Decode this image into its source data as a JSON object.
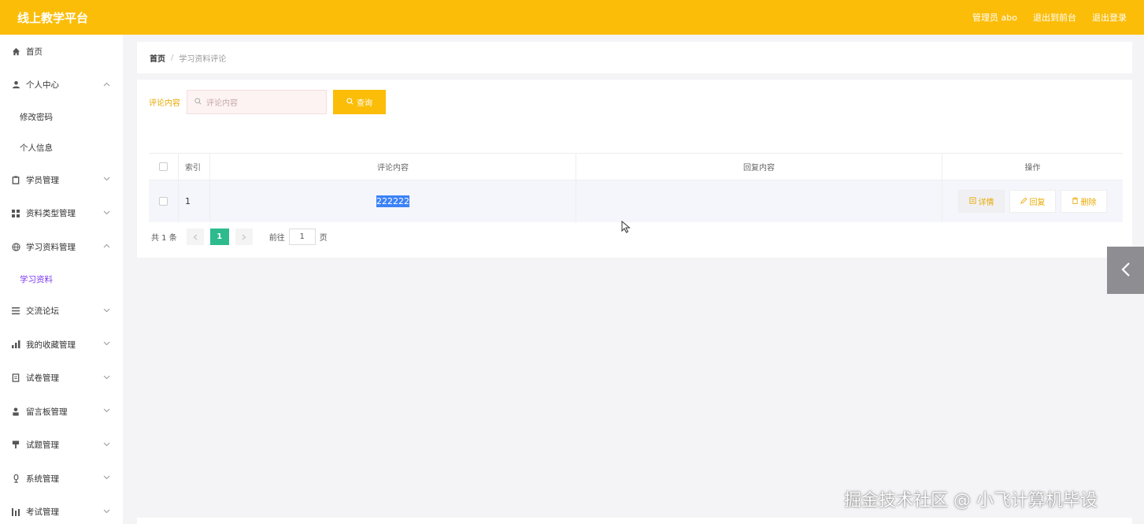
{
  "header": {
    "brand": "线上教学平台",
    "admin_label": "管理员 abo",
    "exit_front": "退出到前台",
    "logout": "退出登录",
    "bg_color": "#fbbd08"
  },
  "sidebar": {
    "items": [
      {
        "label": "首页",
        "icon": "home-icon"
      },
      {
        "label": "个人中心",
        "icon": "user-icon",
        "expanded": true,
        "children": [
          "修改密码",
          "个人信息"
        ]
      },
      {
        "label": "学员管理",
        "icon": "clipboard-icon"
      },
      {
        "label": "资料类型管理",
        "icon": "grid-icon"
      },
      {
        "label": "学习资料管理",
        "icon": "globe-icon",
        "expanded": true,
        "children": [
          "学习资料"
        ]
      },
      {
        "label": "交流论坛",
        "icon": "list-icon"
      },
      {
        "label": "我的收藏管理",
        "icon": "chart-icon"
      },
      {
        "label": "试卷管理",
        "icon": "doc-icon"
      },
      {
        "label": "留言板管理",
        "icon": "person-icon"
      },
      {
        "label": "试题管理",
        "icon": "tag-icon"
      },
      {
        "label": "系统管理",
        "icon": "mic-icon"
      },
      {
        "label": "考试管理",
        "icon": "bars-icon"
      }
    ]
  },
  "breadcrumb": {
    "home": "首页",
    "separator": "/",
    "current": "学习资料评论"
  },
  "search": {
    "label": "评论内容",
    "placeholder": "评论内容",
    "button": "查询"
  },
  "table": {
    "headers": [
      "索引",
      "评论内容",
      "回复内容",
      "操作"
    ],
    "rows": [
      {
        "index": "1",
        "comment": "222222",
        "reply": ""
      }
    ],
    "actions": [
      "详情",
      "回复",
      "删除"
    ]
  },
  "pager": {
    "total": "共 1 条",
    "current_page": "1",
    "goto_label": "前往",
    "goto_value": "1",
    "page_suffix": "页"
  },
  "watermark": "掘金技术社区 @ 小飞计算机毕设"
}
